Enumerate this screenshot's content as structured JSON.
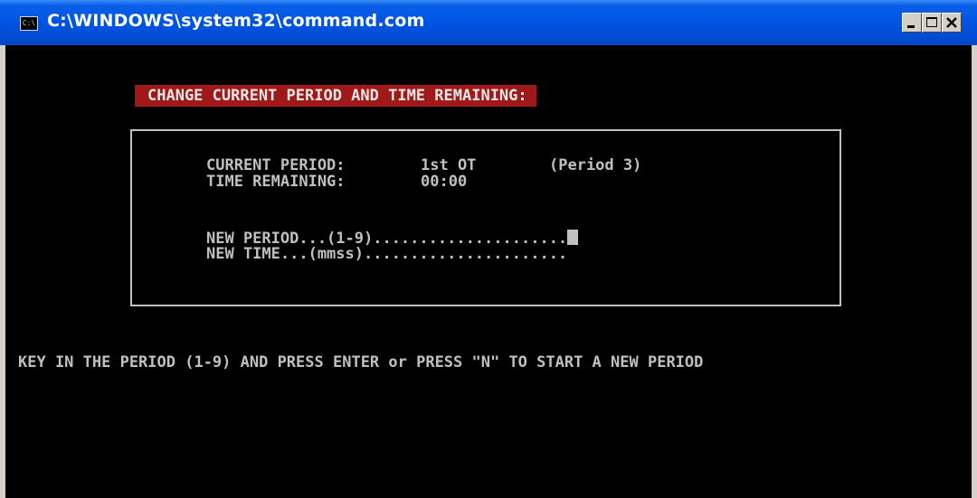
{
  "window": {
    "title": "C:\\WINDOWS\\system32\\command.com",
    "icon": "console-icon",
    "icon_glyph": "C:\\"
  },
  "screen": {
    "header": "CHANGE CURRENT PERIOD AND TIME REMAINING:",
    "current_period_label": "CURRENT PERIOD:",
    "current_period_value": "1st OT",
    "current_period_note": "(Period 3)",
    "time_remaining_label": "TIME REMAINING:",
    "time_remaining_value": "00:00",
    "new_period_prompt": "NEW PERIOD...(1-9).....................",
    "new_time_prompt": "NEW TIME...(mmss)......................",
    "instruction": "KEY IN THE PERIOD (1-9) AND PRESS ENTER or PRESS \"N\" TO START A NEW PERIOD"
  },
  "colors": {
    "title_bar": "#0054e3",
    "console_bg": "#000000",
    "console_text": "#c0c0c0",
    "header_bg": "#a01818"
  }
}
